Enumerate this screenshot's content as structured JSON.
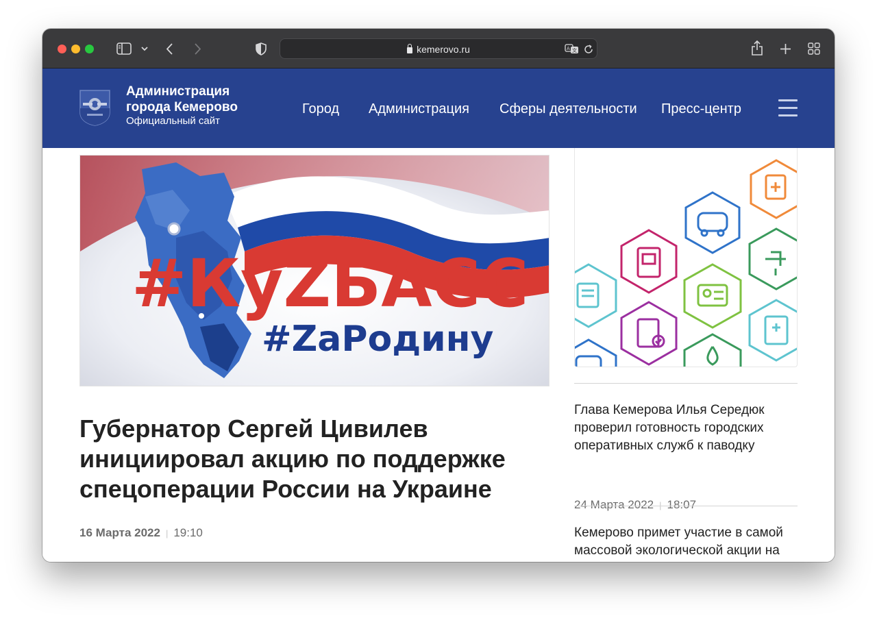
{
  "browser": {
    "url": "kemerovo.ru",
    "icons": [
      "sidebar-icon",
      "chevron-down-icon",
      "back-icon",
      "forward-icon",
      "shield-icon",
      "translate-icon",
      "reload-icon",
      "share-icon",
      "new-tab-icon",
      "tab-overview-icon"
    ]
  },
  "site": {
    "title_line1": "Администрация",
    "title_line2": "города Кемерово",
    "subtitle": "Официальный сайт",
    "nav": [
      "Город",
      "Администрация",
      "Сферы деятельности",
      "Пресс-центр"
    ],
    "colors": {
      "header_bg": "#27428f",
      "text": "#222222",
      "meta": "#6b6b6b"
    }
  },
  "banner": {
    "line1": "#КуZБАСС",
    "line2": "#ZаРодину"
  },
  "main_article": {
    "title": "Губернатор Сергей Цивилев инициировал акцию по поддержке спецоперации России на Украине",
    "date": "16 Марта 2022",
    "time": "19:10"
  },
  "sidebar_news": [
    {
      "title": "Глава Кемерова Илья Середюк проверил готовность городских оперативных служб к паводку",
      "date": "24 Марта 2022",
      "time": "18:07"
    },
    {
      "title": "Кемерово примет участие в самой массовой экологической акции на"
    }
  ]
}
